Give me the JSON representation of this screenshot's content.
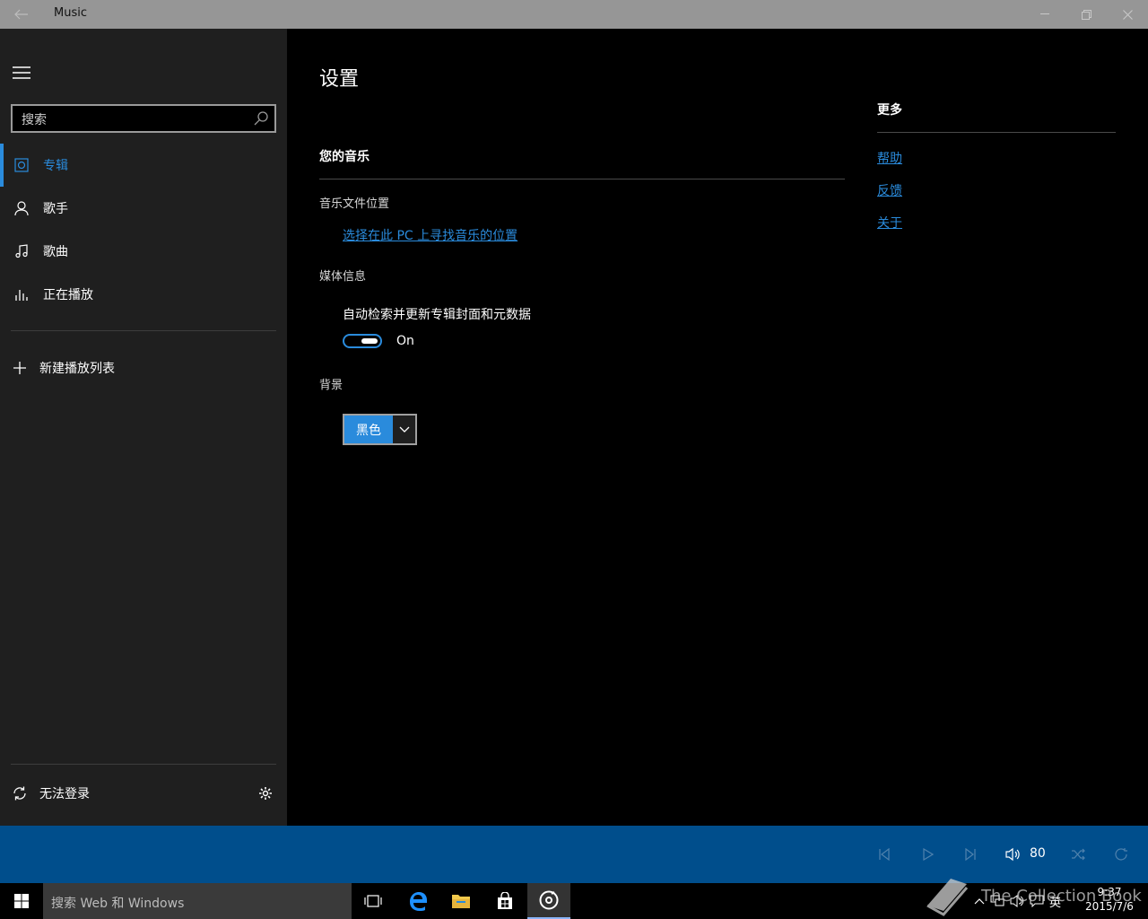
{
  "titlebar": {
    "app_title": "Music"
  },
  "sidebar": {
    "search_placeholder": "搜索",
    "nav": [
      {
        "label": "专辑",
        "icon": "album-icon",
        "active": true
      },
      {
        "label": "歌手",
        "icon": "artist-icon",
        "active": false
      },
      {
        "label": "歌曲",
        "icon": "song-icon",
        "active": false
      },
      {
        "label": "正在播放",
        "icon": "now-playing-icon",
        "active": false
      }
    ],
    "new_playlist": "新建播放列表",
    "sign_in": "无法登录"
  },
  "main": {
    "title": "设置",
    "your_music": {
      "heading": "您的音乐",
      "music_location_label": "音乐文件位置",
      "music_location_link": "选择在此 PC 上寻找音乐的位置",
      "media_info_label": "媒体信息",
      "auto_update_label": "自动检索并更新专辑封面和元数据",
      "toggle_state": "On",
      "background_label": "背景",
      "background_value": "黑色"
    },
    "more": {
      "heading": "更多",
      "links": [
        "帮助",
        "反馈",
        "关于"
      ]
    }
  },
  "player": {
    "volume": "80"
  },
  "taskbar": {
    "search_placeholder": "搜索 Web 和 Windows",
    "tray_lang": "英",
    "time": "9:37",
    "date": "2015/7/6"
  },
  "watermark": {
    "text": "The Collection Book"
  },
  "colors": {
    "accent": "#2a8bdc",
    "playerbar": "#004e8c",
    "sidebar": "#1f1f1f",
    "titlebar": "#969696"
  }
}
